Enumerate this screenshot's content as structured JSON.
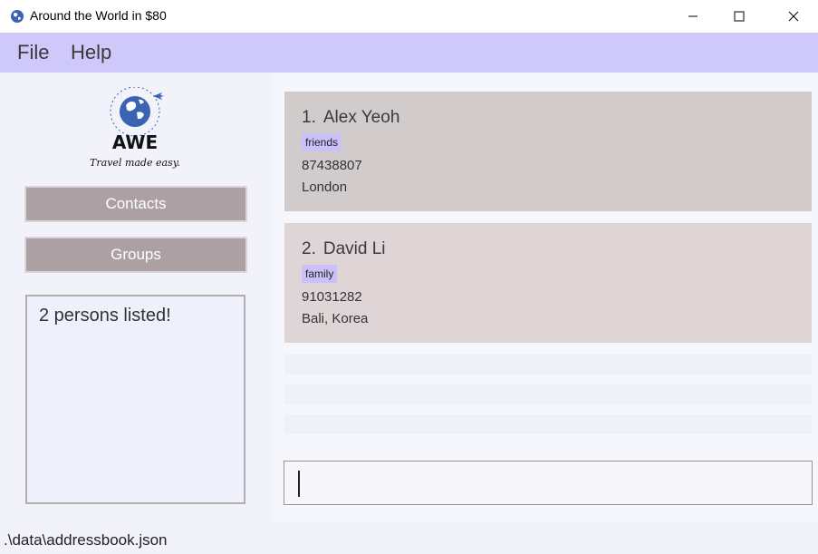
{
  "window": {
    "title": "Around the World in $80",
    "controls": {
      "minimize": "minimize-icon",
      "maximize": "maximize-icon",
      "close": "close-icon"
    }
  },
  "menu": {
    "file": "File",
    "help": "Help"
  },
  "sidebar": {
    "logo": {
      "name": "AWE",
      "tagline": "Travel made easy."
    },
    "contacts_label": "Contacts",
    "groups_label": "Groups",
    "result": "2 persons listed!"
  },
  "persons": [
    {
      "index": "1.",
      "name": "Alex Yeoh",
      "tag": "friends",
      "phone": "87438807",
      "address": "London"
    },
    {
      "index": "2.",
      "name": "David Li",
      "tag": "family",
      "phone": "91031282",
      "address": "Bali, Korea"
    }
  ],
  "command": {
    "value": ""
  },
  "status": {
    "path": ".\\data\\addressbook.json"
  },
  "colors": {
    "menubar": "#cfc8fb",
    "nav_button": "#aca0a5",
    "card_1": "#d1cbcb",
    "card_2": "#dfd5d6",
    "tag": "#cac1fb",
    "logo_blue": "#3a63b3"
  }
}
